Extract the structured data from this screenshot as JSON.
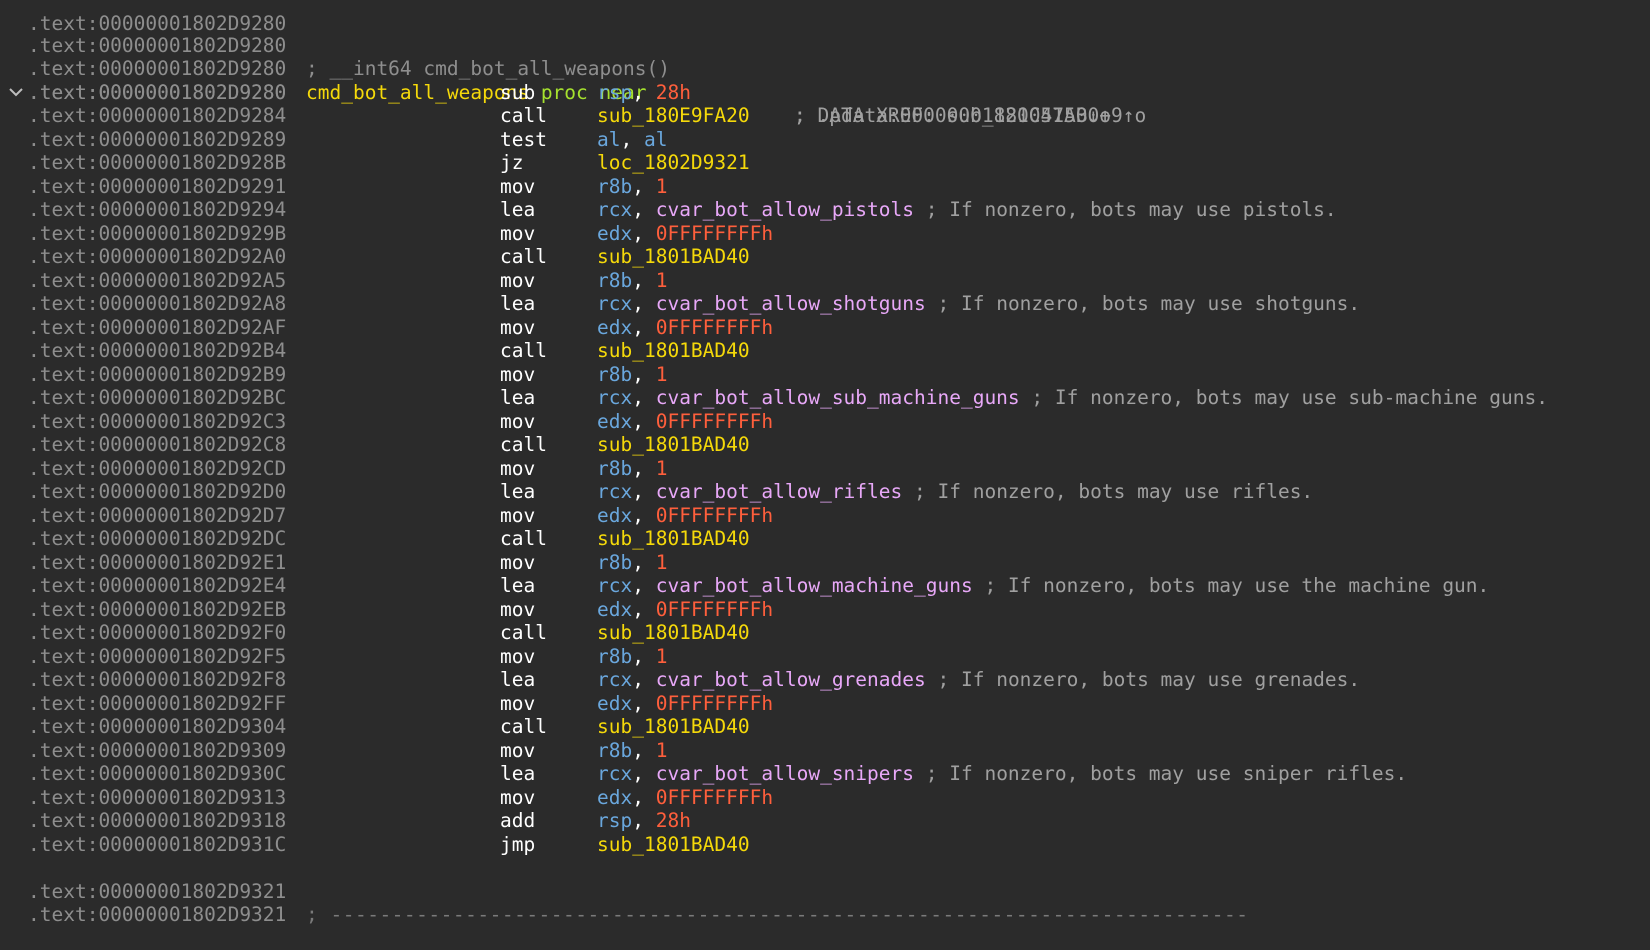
{
  "window": {
    "background": "#2b2b2b"
  },
  "colors": {
    "address": "#8e8e8e",
    "label": "#f5d90a",
    "keyword": "#a6e22e",
    "register": "#6aa7dd",
    "number": "#ff5f3c",
    "symbol": "#e8a8f8",
    "mnemonic": "#ffffff",
    "comment": "#a0a0a0"
  },
  "icons": {
    "collapse": "chevron-down-icon"
  },
  "header": {
    "top_partial_addr": ".text:00000001802D9280",
    "func_comment_addr": ".text:00000001802D9280",
    "func_comment": "; __int64 cmd_bot_all_weapons()",
    "proc_addr": ".text:00000001802D9280",
    "proc_name": "cmd_bot_all_weapons",
    "proc_keyword": "proc near",
    "xref1": "; DATA XREF: sub_1800575B0+9↑o",
    "xref_addr": ".text:00000001802D9280",
    "xref2": "; .pdata:00000001821C41A0↓o"
  },
  "instructions": [
    {
      "addr": ".text:00000001802D9280",
      "mnem": "sub",
      "a": "rsp",
      "ta": "reg",
      "b": "28h",
      "tb": "num",
      "comment": ""
    },
    {
      "addr": ".text:00000001802D9284",
      "mnem": "call",
      "a": "sub_180E9FA20",
      "ta": "label",
      "b": "",
      "tb": "",
      "comment": ""
    },
    {
      "addr": ".text:00000001802D9289",
      "mnem": "test",
      "a": "al",
      "ta": "reg",
      "b": "al",
      "tb": "reg",
      "comment": ""
    },
    {
      "addr": ".text:00000001802D928B",
      "mnem": "jz",
      "a": "loc_1802D9321",
      "ta": "label",
      "b": "",
      "tb": "",
      "comment": ""
    },
    {
      "addr": ".text:00000001802D9291",
      "mnem": "mov",
      "a": "r8b",
      "ta": "reg",
      "b": "1",
      "tb": "num",
      "comment": ""
    },
    {
      "addr": ".text:00000001802D9294",
      "mnem": "lea",
      "a": "rcx",
      "ta": "reg",
      "b": "cvar_bot_allow_pistols",
      "tb": "sym",
      "comment": "; If nonzero, bots may use pistols."
    },
    {
      "addr": ".text:00000001802D929B",
      "mnem": "mov",
      "a": "edx",
      "ta": "reg",
      "b": "0FFFFFFFFh",
      "tb": "num",
      "comment": ""
    },
    {
      "addr": ".text:00000001802D92A0",
      "mnem": "call",
      "a": "sub_1801BAD40",
      "ta": "label",
      "b": "",
      "tb": "",
      "comment": ""
    },
    {
      "addr": ".text:00000001802D92A5",
      "mnem": "mov",
      "a": "r8b",
      "ta": "reg",
      "b": "1",
      "tb": "num",
      "comment": ""
    },
    {
      "addr": ".text:00000001802D92A8",
      "mnem": "lea",
      "a": "rcx",
      "ta": "reg",
      "b": "cvar_bot_allow_shotguns",
      "tb": "sym",
      "comment": "; If nonzero, bots may use shotguns."
    },
    {
      "addr": ".text:00000001802D92AF",
      "mnem": "mov",
      "a": "edx",
      "ta": "reg",
      "b": "0FFFFFFFFh",
      "tb": "num",
      "comment": ""
    },
    {
      "addr": ".text:00000001802D92B4",
      "mnem": "call",
      "a": "sub_1801BAD40",
      "ta": "label",
      "b": "",
      "tb": "",
      "comment": ""
    },
    {
      "addr": ".text:00000001802D92B9",
      "mnem": "mov",
      "a": "r8b",
      "ta": "reg",
      "b": "1",
      "tb": "num",
      "comment": ""
    },
    {
      "addr": ".text:00000001802D92BC",
      "mnem": "lea",
      "a": "rcx",
      "ta": "reg",
      "b": "cvar_bot_allow_sub_machine_guns",
      "tb": "sym",
      "comment": "; If nonzero, bots may use sub-machine guns."
    },
    {
      "addr": ".text:00000001802D92C3",
      "mnem": "mov",
      "a": "edx",
      "ta": "reg",
      "b": "0FFFFFFFFh",
      "tb": "num",
      "comment": ""
    },
    {
      "addr": ".text:00000001802D92C8",
      "mnem": "call",
      "a": "sub_1801BAD40",
      "ta": "label",
      "b": "",
      "tb": "",
      "comment": ""
    },
    {
      "addr": ".text:00000001802D92CD",
      "mnem": "mov",
      "a": "r8b",
      "ta": "reg",
      "b": "1",
      "tb": "num",
      "comment": ""
    },
    {
      "addr": ".text:00000001802D92D0",
      "mnem": "lea",
      "a": "rcx",
      "ta": "reg",
      "b": "cvar_bot_allow_rifles",
      "tb": "sym",
      "comment": "; If nonzero, bots may use rifles."
    },
    {
      "addr": ".text:00000001802D92D7",
      "mnem": "mov",
      "a": "edx",
      "ta": "reg",
      "b": "0FFFFFFFFh",
      "tb": "num",
      "comment": ""
    },
    {
      "addr": ".text:00000001802D92DC",
      "mnem": "call",
      "a": "sub_1801BAD40",
      "ta": "label",
      "b": "",
      "tb": "",
      "comment": ""
    },
    {
      "addr": ".text:00000001802D92E1",
      "mnem": "mov",
      "a": "r8b",
      "ta": "reg",
      "b": "1",
      "tb": "num",
      "comment": ""
    },
    {
      "addr": ".text:00000001802D92E4",
      "mnem": "lea",
      "a": "rcx",
      "ta": "reg",
      "b": "cvar_bot_allow_machine_guns",
      "tb": "sym",
      "comment": "; If nonzero, bots may use the machine gun."
    },
    {
      "addr": ".text:00000001802D92EB",
      "mnem": "mov",
      "a": "edx",
      "ta": "reg",
      "b": "0FFFFFFFFh",
      "tb": "num",
      "comment": ""
    },
    {
      "addr": ".text:00000001802D92F0",
      "mnem": "call",
      "a": "sub_1801BAD40",
      "ta": "label",
      "b": "",
      "tb": "",
      "comment": ""
    },
    {
      "addr": ".text:00000001802D92F5",
      "mnem": "mov",
      "a": "r8b",
      "ta": "reg",
      "b": "1",
      "tb": "num",
      "comment": ""
    },
    {
      "addr": ".text:00000001802D92F8",
      "mnem": "lea",
      "a": "rcx",
      "ta": "reg",
      "b": "cvar_bot_allow_grenades",
      "tb": "sym",
      "comment": "; If nonzero, bots may use grenades."
    },
    {
      "addr": ".text:00000001802D92FF",
      "mnem": "mov",
      "a": "edx",
      "ta": "reg",
      "b": "0FFFFFFFFh",
      "tb": "num",
      "comment": ""
    },
    {
      "addr": ".text:00000001802D9304",
      "mnem": "call",
      "a": "sub_1801BAD40",
      "ta": "label",
      "b": "",
      "tb": "",
      "comment": ""
    },
    {
      "addr": ".text:00000001802D9309",
      "mnem": "mov",
      "a": "r8b",
      "ta": "reg",
      "b": "1",
      "tb": "num",
      "comment": ""
    },
    {
      "addr": ".text:00000001802D930C",
      "mnem": "lea",
      "a": "rcx",
      "ta": "reg",
      "b": "cvar_bot_allow_snipers",
      "tb": "sym",
      "comment": "; If nonzero, bots may use sniper rifles."
    },
    {
      "addr": ".text:00000001802D9313",
      "mnem": "mov",
      "a": "edx",
      "ta": "reg",
      "b": "0FFFFFFFFh",
      "tb": "num",
      "comment": ""
    },
    {
      "addr": ".text:00000001802D9318",
      "mnem": "add",
      "a": "rsp",
      "ta": "reg",
      "b": "28h",
      "tb": "num",
      "comment": ""
    },
    {
      "addr": ".text:00000001802D931C",
      "mnem": "jmp",
      "a": "sub_1801BAD40",
      "ta": "label",
      "b": "",
      "tb": "",
      "comment": ""
    }
  ],
  "footer": {
    "sep_addr": ".text:00000001802D9321",
    "sep_text": "; ---------------------------------------------------------------------------",
    "bottom_partial_addr": ".text:00000001802D9321"
  }
}
